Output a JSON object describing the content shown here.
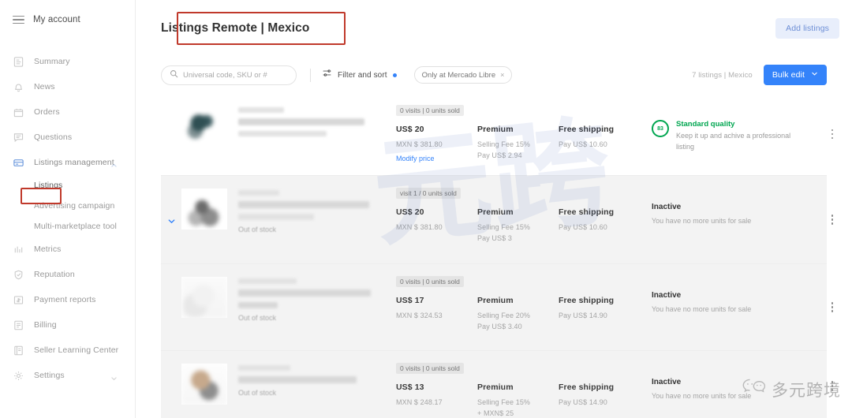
{
  "sidebar": {
    "account_label": "My account",
    "menu_icon": "hamburger-icon",
    "items": [
      {
        "label": "Summary",
        "icon": "summary-icon"
      },
      {
        "label": "News",
        "icon": "bell-icon"
      },
      {
        "label": "Orders",
        "icon": "orders-icon"
      },
      {
        "label": "Questions",
        "icon": "chat-icon"
      },
      {
        "label": "Listings management",
        "icon": "listings-icon",
        "expanded": true,
        "chevron": "chevron-up-icon"
      },
      {
        "label": "Listings",
        "sub": true,
        "current": true
      },
      {
        "label": "Advertising campaign",
        "sub": true
      },
      {
        "label": "Multi-marketplace tool",
        "sub": true
      },
      {
        "label": "Metrics",
        "icon": "chart-icon"
      },
      {
        "label": "Reputation",
        "icon": "shield-icon"
      },
      {
        "label": "Payment reports",
        "icon": "money-icon"
      },
      {
        "label": "Billing",
        "icon": "document-icon"
      },
      {
        "label": "Seller Learning Center",
        "icon": "book-icon"
      },
      {
        "label": "Settings",
        "icon": "gear-icon",
        "chevron": "chevron-down-icon"
      }
    ]
  },
  "header": {
    "title": "Listings Remote | Mexico",
    "add_listings_label": "Add listings"
  },
  "toolbar": {
    "search_placeholder": "Universal code, SKU or #",
    "search_value": "",
    "search_icon": "search-icon",
    "filter_label": "Filter and sort",
    "filter_icon": "filter-icon",
    "filter_has_badge": true,
    "chip_label": "Only at Mercado Libre",
    "chip_close": "×",
    "count_label": "7 listings | Mexico",
    "bulk_label": "Bulk edit",
    "bulk_chevron": "chevron-down-icon"
  },
  "colors": {
    "accent_blue": "#3483fa",
    "quality_green": "#00a650",
    "annotation_red": "#c0392b",
    "shaded_row": "#f3f3f3"
  },
  "listings": [
    {
      "shaded": false,
      "expandable": false,
      "visits": "0 visits | 0 units sold",
      "stock": "",
      "price_usd": "US$ 20",
      "price_mxn": "MXN $ 381.80",
      "price_link": "Modify price",
      "plan": "Premium",
      "fee": "Selling Fee 15%",
      "fee_pay": "Pay US$ 2.94",
      "shipping": "Free shipping",
      "shipping_pay": "Pay US$ 10.60",
      "quality": {
        "score": "83",
        "title": "Standard quality",
        "text": "Keep it up and achive a professional listing",
        "link_text": "achive a professional listing"
      },
      "status": null
    },
    {
      "shaded": true,
      "expandable": true,
      "visits": "visit 1 / 0 units sold",
      "stock": "Out of stock",
      "price_usd": "US$ 20",
      "price_mxn": "MXN $ 381.80",
      "price_link": "",
      "plan": "Premium",
      "fee": "Selling Fee 15%",
      "fee_pay": "Pay US$ 3",
      "shipping": "Free shipping",
      "shipping_pay": "Pay US$ 10.60",
      "quality": null,
      "status": {
        "title": "Inactive",
        "text": "You have no more units for sale"
      }
    },
    {
      "shaded": true,
      "expandable": false,
      "visits": "0 visits | 0 units sold",
      "stock": "Out of stock",
      "price_usd": "US$ 17",
      "price_mxn": "MXN $ 324.53",
      "price_link": "",
      "plan": "Premium",
      "fee": "Selling Fee 20%",
      "fee_pay": "Pay US$ 3.40",
      "shipping": "Free shipping",
      "shipping_pay": "Pay US$ 14.90",
      "quality": null,
      "status": {
        "title": "Inactive",
        "text": "You have no more units for sale"
      }
    },
    {
      "shaded": true,
      "expandable": false,
      "visits": "0 visits | 0 units sold",
      "stock": "Out of stock",
      "price_usd": "US$ 13",
      "price_mxn": "MXN $ 248.17",
      "price_link": "",
      "plan": "Premium",
      "fee": "Selling Fee 15%",
      "fee_pay": "+ MXN$ 25",
      "shipping": "Free shipping",
      "shipping_pay": "Pay US$ 14.90",
      "quality": null,
      "status": {
        "title": "Inactive",
        "text": "You have no more units for sale"
      }
    }
  ],
  "watermarks": {
    "center_text": "元跨",
    "wechat_text": "多元跨境",
    "wechat_icon": "wechat-icon"
  }
}
